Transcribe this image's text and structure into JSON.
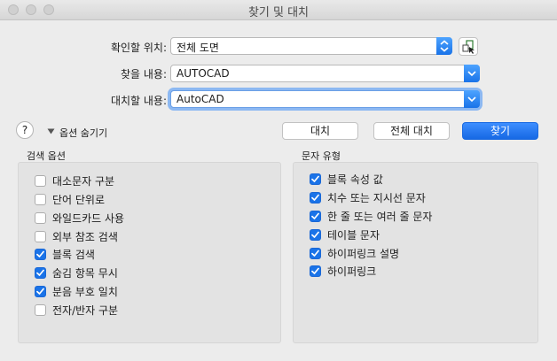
{
  "window": {
    "title": "찾기 및 대치"
  },
  "form": {
    "scope_label": "확인할 위치:",
    "scope_value": "전체 도면",
    "find_label": "찾을 내용:",
    "find_value": "AUTOCAD",
    "replace_label": "대치할 내용:",
    "replace_value": "AutoCAD"
  },
  "toolbar": {
    "help_label": "?",
    "options_toggle_label": "옵션 숨기기",
    "replace_label": "대치",
    "replace_all_label": "전체 대치",
    "find_label": "찾기"
  },
  "search_options": {
    "title": "검색 옵션",
    "items": [
      {
        "label": "대소문자 구분",
        "checked": false
      },
      {
        "label": "단어 단위로",
        "checked": false
      },
      {
        "label": "와일드카드 사용",
        "checked": false
      },
      {
        "label": "외부 참조 검색",
        "checked": false
      },
      {
        "label": "블록 검색",
        "checked": true
      },
      {
        "label": "숨김 항목 무시",
        "checked": true
      },
      {
        "label": "분음 부호 일치",
        "checked": true
      },
      {
        "label": "전자/반자 구분",
        "checked": false
      }
    ]
  },
  "text_types": {
    "title": "문자 유형",
    "items": [
      {
        "label": "블록 속성 값",
        "checked": true
      },
      {
        "label": "치수 또는 지시선 문자",
        "checked": true
      },
      {
        "label": "한 줄 또는 여러 줄 문자",
        "checked": true
      },
      {
        "label": "테이블 문자",
        "checked": true
      },
      {
        "label": "하이퍼링크 설명",
        "checked": true
      },
      {
        "label": "하이퍼링크",
        "checked": true
      }
    ]
  },
  "colors": {
    "accent": "#1a73e8"
  }
}
